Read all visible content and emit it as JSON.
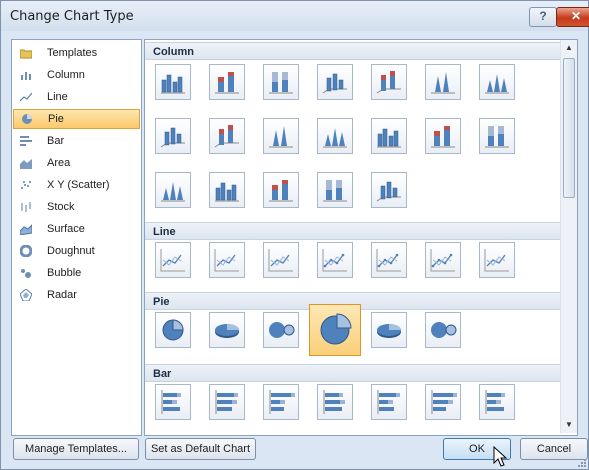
{
  "window": {
    "title": "Change Chart Type",
    "help_label": "?",
    "close_label": "✕"
  },
  "left_list": {
    "items": [
      {
        "label": "Templates",
        "icon": "folder-icon"
      },
      {
        "label": "Column",
        "icon": "column-chart-icon"
      },
      {
        "label": "Line",
        "icon": "line-chart-icon"
      },
      {
        "label": "Pie",
        "icon": "pie-chart-icon",
        "selected": true
      },
      {
        "label": "Bar",
        "icon": "bar-chart-icon"
      },
      {
        "label": "Area",
        "icon": "area-chart-icon"
      },
      {
        "label": "X Y (Scatter)",
        "icon": "scatter-chart-icon"
      },
      {
        "label": "Stock",
        "icon": "stock-chart-icon"
      },
      {
        "label": "Surface",
        "icon": "surface-chart-icon"
      },
      {
        "label": "Doughnut",
        "icon": "doughnut-chart-icon"
      },
      {
        "label": "Bubble",
        "icon": "bubble-chart-icon"
      },
      {
        "label": "Radar",
        "icon": "radar-chart-icon"
      }
    ]
  },
  "gallery": {
    "sections": [
      {
        "label": "Column",
        "count": 19
      },
      {
        "label": "Line",
        "count": 7
      },
      {
        "label": "Pie",
        "count": 6,
        "selected_index": 3
      },
      {
        "label": "Bar",
        "count": 7
      }
    ]
  },
  "buttons": {
    "manage_templates": "Manage Templates...",
    "set_default": "Set as Default Chart",
    "ok": "OK",
    "cancel": "Cancel"
  },
  "colors": {
    "accent_selection": "#fbc96a",
    "chart_blue": "#4f81bd"
  }
}
